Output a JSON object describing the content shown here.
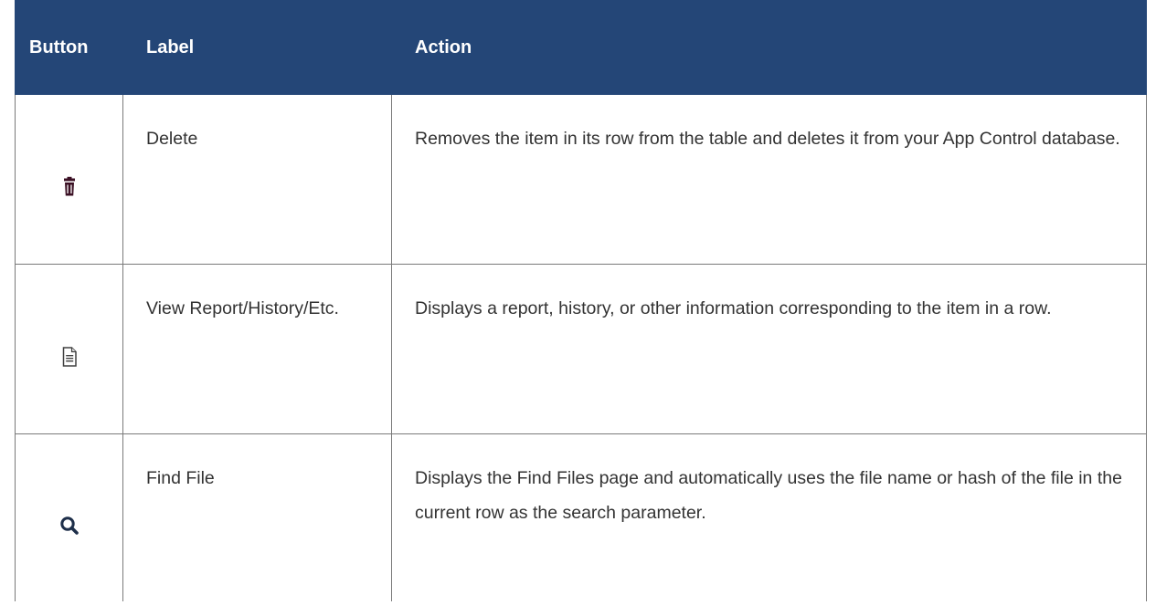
{
  "header": {
    "button": "Button",
    "label": "Label",
    "action": "Action"
  },
  "rows": [
    {
      "icon": "trash-icon",
      "label": "Delete",
      "action": "Removes the item in its row from the table and deletes it from your App Control database."
    },
    {
      "icon": "document-icon",
      "label": "View Report/History/Etc.",
      "action": "Displays a report, history, or other information corresponding to the item in a row."
    },
    {
      "icon": "search-icon",
      "label": "Find File",
      "action": "Displays the Find Files page and automatically uses the file name or hash of the file in the current row as the search parameter."
    }
  ],
  "colors": {
    "header_bg": "#244677",
    "trash_icon": "#3b1024",
    "border": "#7a7a7a"
  }
}
